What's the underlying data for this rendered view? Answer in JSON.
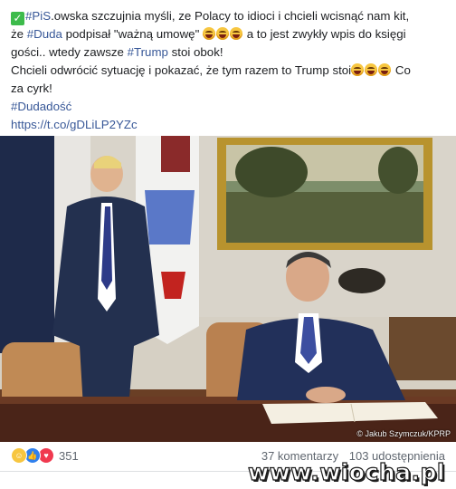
{
  "post": {
    "line1_text": "#PiS.owska szczujnia myśli, ze Polacy to idioci i chcieli wcisnąć nam kit,",
    "line2_pre": "że ",
    "line2_tag": "#Duda",
    "line2_mid": " podpisał \"ważną umowę\" ",
    "line2_post": " a to jest zwykły wpis do księgi",
    "line3_pre": "gości.. wtedy zawsze ",
    "line3_tag": "#Trump",
    "line3_post": " stoi obok!",
    "line4_pre": "Chcieli odwrócić sytuację i pokazać, że tym razem to Trump stoi",
    "line4_post": " Co",
    "line5": "za cyrk!",
    "hashtag": "#Dudadość",
    "link": "https://t.co/gDLiLP2YZc"
  },
  "photo": {
    "credit": "© Jakub Szymczuk/KPRP"
  },
  "footer": {
    "reaction_count": "351",
    "comments": "37 komentarzy",
    "shares": "103 udostępnienia"
  },
  "watermark": "www.wiocha.pl",
  "icons": [
    "check-icon",
    "laughing-emoji",
    "haha-reaction-icon",
    "like-reaction-icon",
    "love-reaction-icon"
  ]
}
